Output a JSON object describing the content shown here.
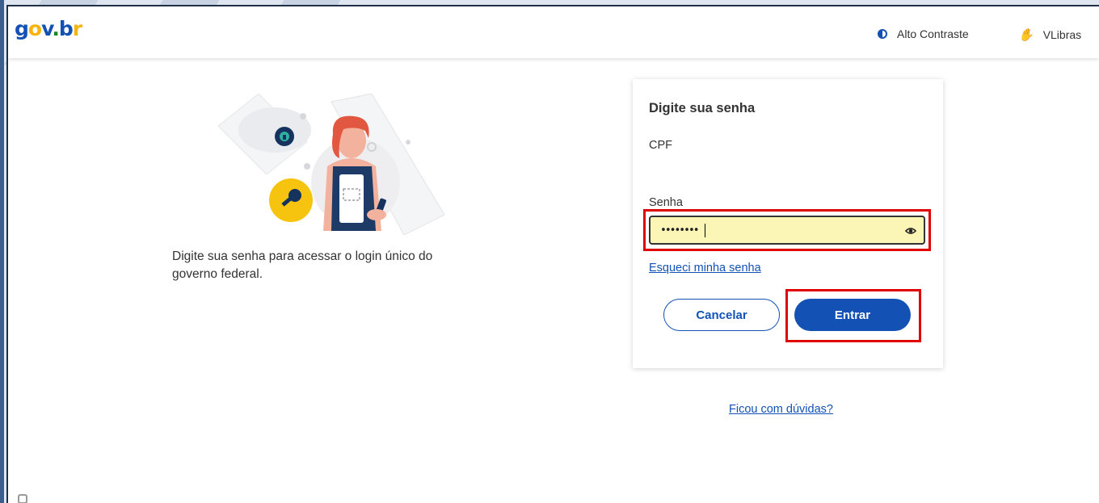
{
  "header": {
    "logo": {
      "g": "g",
      "o": "o",
      "v": "v",
      "dot": ".",
      "b": "b",
      "r": "r"
    },
    "alto_contraste": "Alto Contraste",
    "vlibras": "VLibras"
  },
  "intro": {
    "text": "Digite sua senha para acessar o login único do governo federal."
  },
  "card": {
    "title": "Digite sua senha",
    "cpf_label": "CPF",
    "senha_label": "Senha",
    "password_value": "••••••••",
    "forgot_link": "Esqueci minha senha",
    "cancel_label": "Cancelar",
    "enter_label": "Entrar"
  },
  "help_link": "Ficou com dúvidas?",
  "colors": {
    "primary": "#1351b4",
    "highlight": "#e00000",
    "input_bg": "#fbf5b6",
    "brand_yellow": "#f6b40e",
    "brand_green": "#168821"
  },
  "icons": {
    "contrast": "contrast-icon",
    "vlibras": "vlibras-hand-icon",
    "password_toggle": "eye-icon",
    "key": "key-icon",
    "lock": "lock-icon"
  }
}
